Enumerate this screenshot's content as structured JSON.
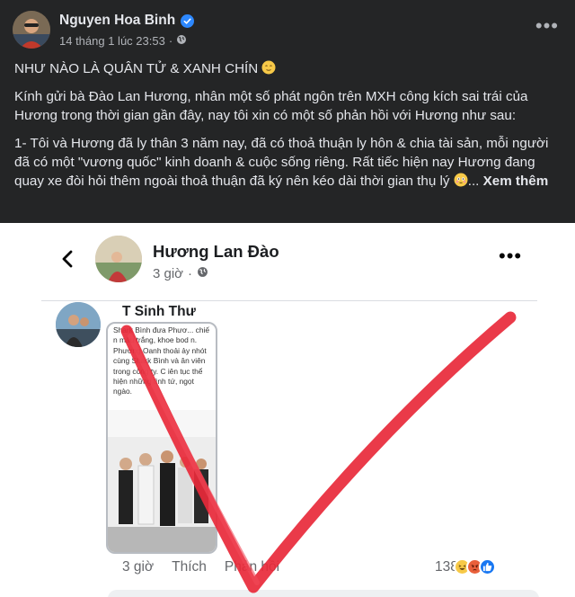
{
  "post": {
    "author": "Nguyen Hoa Binh",
    "timestamp": "14 tháng 1 lúc 23:53",
    "separator": "·",
    "headline": "NHƯ NÀO LÀ QUÂN TỬ & XANH CHÍN",
    "paragraph_1": "Kính gửi bà Đào Lan Hương, nhân một số phát ngôn trên MXH công kích sai trái của Hương trong thời gian gần đây, nay tôi xin có một số phản hồi với Hương như sau:",
    "paragraph_2": "1- Tôi và Hương đã ly thân 3 năm nay, đã có thoả thuận ly hôn & chia tài sản, mỗi người đã có một \"vương quốc\" kinh doanh & cuộc sống riêng. Rất tiếc hiện nay Hương đang quay xe đòi hỏi thêm ngoài thoả thuận đã ký nên kéo dài thời gian thụ lý",
    "ellipsis": "...",
    "see_more": "Xem thêm"
  },
  "embedded": {
    "profile_name": "Hương Lan Đào",
    "profile_time": "3 giờ",
    "profile_separator": "·",
    "comment_author": "T Sinh Thư",
    "card_text": "Shark Bình đưa Phươ... chiế     n màu trắng, khoe bod       n. Phương Oanh thoải         ảy nhót cùng Shark Bình và      ân viên trong công ty. C         iên tục thể hiện những       tình tứ, ngọt ngào.",
    "comment_time": "3 giờ",
    "like_label": "Thích",
    "reply_label": "Phản hồi",
    "reaction_count": "138"
  },
  "icons": {
    "verified": "verified-badge-icon",
    "globe": "globe-icon",
    "more": "more-horizontal-icon",
    "back": "back-arrow-icon",
    "haha": "haha-reaction-icon",
    "angry": "angry-reaction-icon",
    "like": "like-reaction-icon",
    "emoji": "relieved-face-emoji",
    "emoji_2": "flushed-face-emoji"
  },
  "colors": {
    "background_dark": "#242526",
    "text_primary": "#e4e6eb",
    "text_secondary": "#b0b3b8",
    "accent_blue": "#2d88ff",
    "annotation_red": "#e8293a"
  }
}
